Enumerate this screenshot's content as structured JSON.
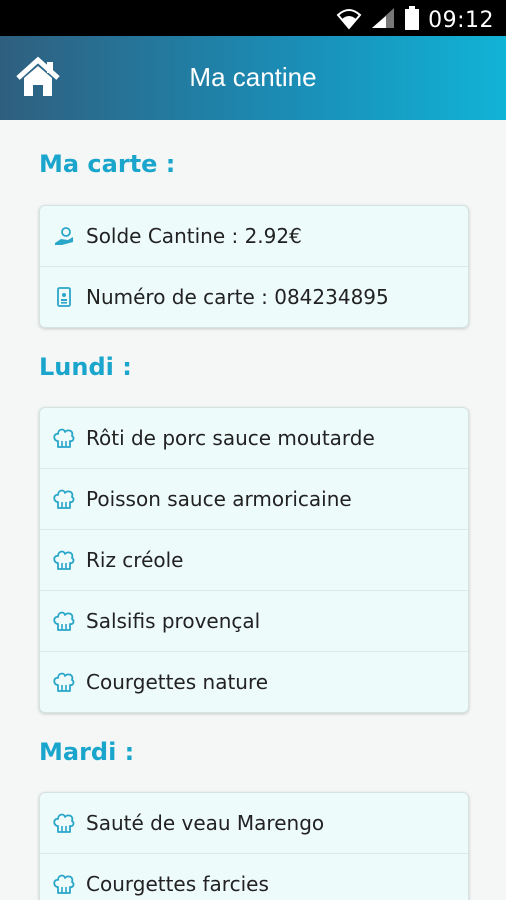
{
  "status": {
    "time": "09:12"
  },
  "header": {
    "title": "Ma cantine"
  },
  "carte": {
    "title": "Ma carte :",
    "items": [
      {
        "text": "Solde Cantine : 2.92€",
        "icon": "wallet-icon"
      },
      {
        "text": "Numéro de carte : 084234895",
        "icon": "id-card-icon"
      }
    ]
  },
  "lundi": {
    "title": "Lundi :",
    "items": [
      {
        "text": "Rôti de porc sauce moutarde",
        "icon": "chef-hat-icon"
      },
      {
        "text": "Poisson sauce armoricaine",
        "icon": "chef-hat-icon"
      },
      {
        "text": "Riz créole",
        "icon": "chef-hat-icon"
      },
      {
        "text": "Salsifis provençal",
        "icon": "chef-hat-icon"
      },
      {
        "text": "Courgettes nature",
        "icon": "chef-hat-icon"
      }
    ]
  },
  "mardi": {
    "title": "Mardi :",
    "items": [
      {
        "text": "Sauté de veau Marengo",
        "icon": "chef-hat-icon"
      },
      {
        "text": "Courgettes farcies",
        "icon": "chef-hat-icon"
      }
    ]
  }
}
